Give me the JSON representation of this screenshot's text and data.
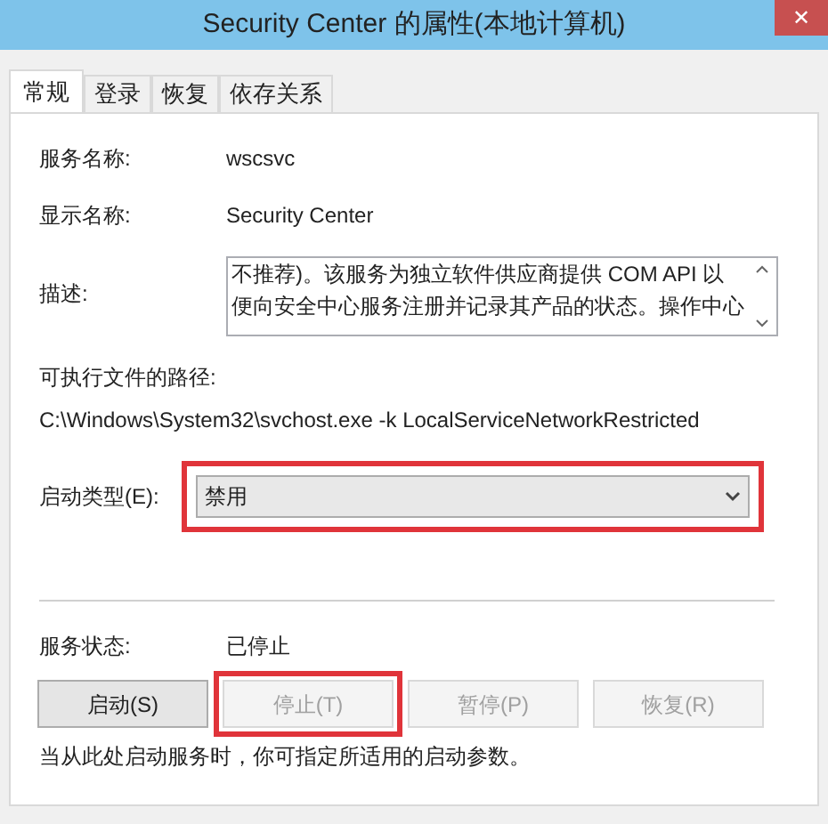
{
  "window": {
    "title": "Security Center 的属性(本地计算机)",
    "close": "✕"
  },
  "tabs": [
    {
      "label": "常规",
      "selected": true
    },
    {
      "label": "登录",
      "selected": false
    },
    {
      "label": "恢复",
      "selected": false
    },
    {
      "label": "依存关系",
      "selected": false
    }
  ],
  "fields": [
    {
      "label": "服务名称:",
      "value": "wscsvc"
    },
    {
      "label": "显示名称:",
      "value": "Security Center"
    }
  ],
  "description": {
    "label": "描述:",
    "lines": [
      "不推荐)。该服务为独立软件供应商提供 COM API 以",
      "便向安全中心服务注册并记录其产品的状态。操作中心"
    ]
  },
  "executable_path": {
    "label": "可执行文件的路径:",
    "value": "C:\\Windows\\System32\\svchost.exe -k LocalServiceNetworkRestricted"
  },
  "startup_type": {
    "label": "启动类型(E):",
    "value": "禁用",
    "highlighted": true
  },
  "service_status": {
    "label": "服务状态:",
    "value": "已停止"
  },
  "buttons": [
    {
      "label": "启动(S)",
      "disabled": false,
      "highlighted": false
    },
    {
      "label": "停止(T)",
      "disabled": true,
      "highlighted": true
    },
    {
      "label": "暂停(P)",
      "disabled": true,
      "highlighted": false
    },
    {
      "label": "恢复(R)",
      "disabled": true,
      "highlighted": false
    }
  ],
  "note": "当从此处启动服务时，你可指定所适用的启动参数。"
}
